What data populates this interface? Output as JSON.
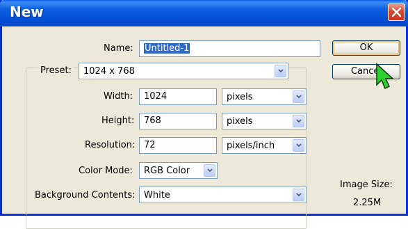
{
  "window": {
    "title": "New"
  },
  "form": {
    "name_label": "Name:",
    "name_value": "Untitled-1",
    "preset_label": "Preset:",
    "preset_value": "1024 x 768",
    "width_label": "Width:",
    "width_value": "1024",
    "width_unit": "pixels",
    "height_label": "Height:",
    "height_value": "768",
    "height_unit": "pixels",
    "resolution_label": "Resolution:",
    "resolution_value": "72",
    "resolution_unit": "pixels/inch",
    "color_mode_label": "Color Mode:",
    "color_mode_value": "RGB Color",
    "background_label": "Background Contents:",
    "background_value": "White"
  },
  "buttons": {
    "ok": "OK",
    "cancel": "Cancel"
  },
  "info": {
    "image_size_label": "Image Size:",
    "image_size_value": "2.25M"
  },
  "colors": {
    "titlebar": "#0d5fe0",
    "dialog_bg": "#ece9d8",
    "selection": "#316ac5",
    "close": "#d4492f"
  }
}
